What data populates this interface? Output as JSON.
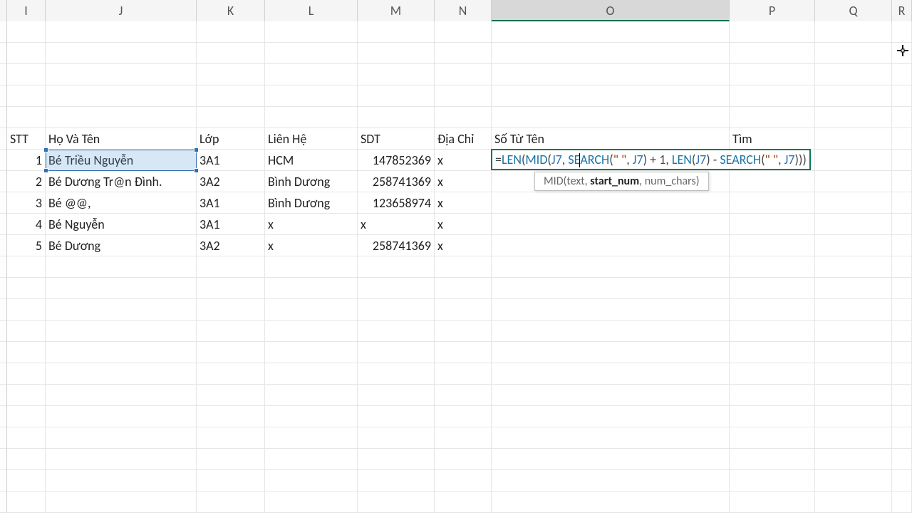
{
  "columns": [
    "I",
    "J",
    "K",
    "L",
    "M",
    "N",
    "O",
    "P",
    "Q",
    "R"
  ],
  "selected_column": "O",
  "headers": {
    "I": "STT",
    "J": "Họ Và Tên",
    "K": "Lớp",
    "L": "Liên Hệ",
    "M": "SDT",
    "N": "Địa Chỉ",
    "O": "Số Từ Tên",
    "P": "Tìm"
  },
  "rows": [
    {
      "I": "1",
      "J": "Bé Triều Nguyễn",
      "K": "3A1",
      "L": "HCM",
      "M": "147852369",
      "N": "x"
    },
    {
      "I": "2",
      "J": "Bé Dương Tr@n Đình.",
      "K": "3A2",
      "L": "Bình Dương",
      "M": "258741369",
      "N": "x"
    },
    {
      "I": "3",
      "J": "Bé @@,",
      "K": "3A1",
      "L": "Bình Dương",
      "M": "123658974",
      "N": "x"
    },
    {
      "I": "4",
      "J": "Bé Nguyễn",
      "K": "3A1",
      "L": "x",
      "M": "x",
      "N": "x"
    },
    {
      "I": "5",
      "J": "Bé Dương",
      "K": "3A2",
      "L": "x",
      "M": "258741369",
      "N": "x"
    }
  ],
  "formula": {
    "tokens": [
      {
        "t": "op",
        "v": "="
      },
      {
        "t": "fn",
        "v": "LEN"
      },
      {
        "t": "op",
        "v": "("
      },
      {
        "t": "fn",
        "v": "MID"
      },
      {
        "t": "op",
        "v": "("
      },
      {
        "t": "ref",
        "v": "J7"
      },
      {
        "t": "op",
        "v": ", "
      },
      {
        "t": "fn",
        "v": "SE"
      },
      {
        "t": "caret",
        "v": ""
      },
      {
        "t": "fn",
        "v": "ARCH"
      },
      {
        "t": "op",
        "v": "("
      },
      {
        "t": "str",
        "v": "\" \""
      },
      {
        "t": "op",
        "v": ", "
      },
      {
        "t": "ref",
        "v": "J7"
      },
      {
        "t": "op",
        "v": ") + "
      },
      {
        "t": "num",
        "v": "1"
      },
      {
        "t": "op",
        "v": ", "
      },
      {
        "t": "fn",
        "v": "LEN"
      },
      {
        "t": "op",
        "v": "("
      },
      {
        "t": "ref",
        "v": "J7"
      },
      {
        "t": "op",
        "v": ") - "
      },
      {
        "t": "fn",
        "v": "SEARCH"
      },
      {
        "t": "op",
        "v": "("
      },
      {
        "t": "str",
        "v": "\" \""
      },
      {
        "t": "op",
        "v": ", "
      },
      {
        "t": "ref",
        "v": "J7"
      },
      {
        "t": "op",
        "v": ")))"
      }
    ]
  },
  "tooltip": {
    "fn": "MID",
    "args": [
      "text",
      "start_num",
      "num_chars"
    ],
    "current_arg_index": 1
  }
}
